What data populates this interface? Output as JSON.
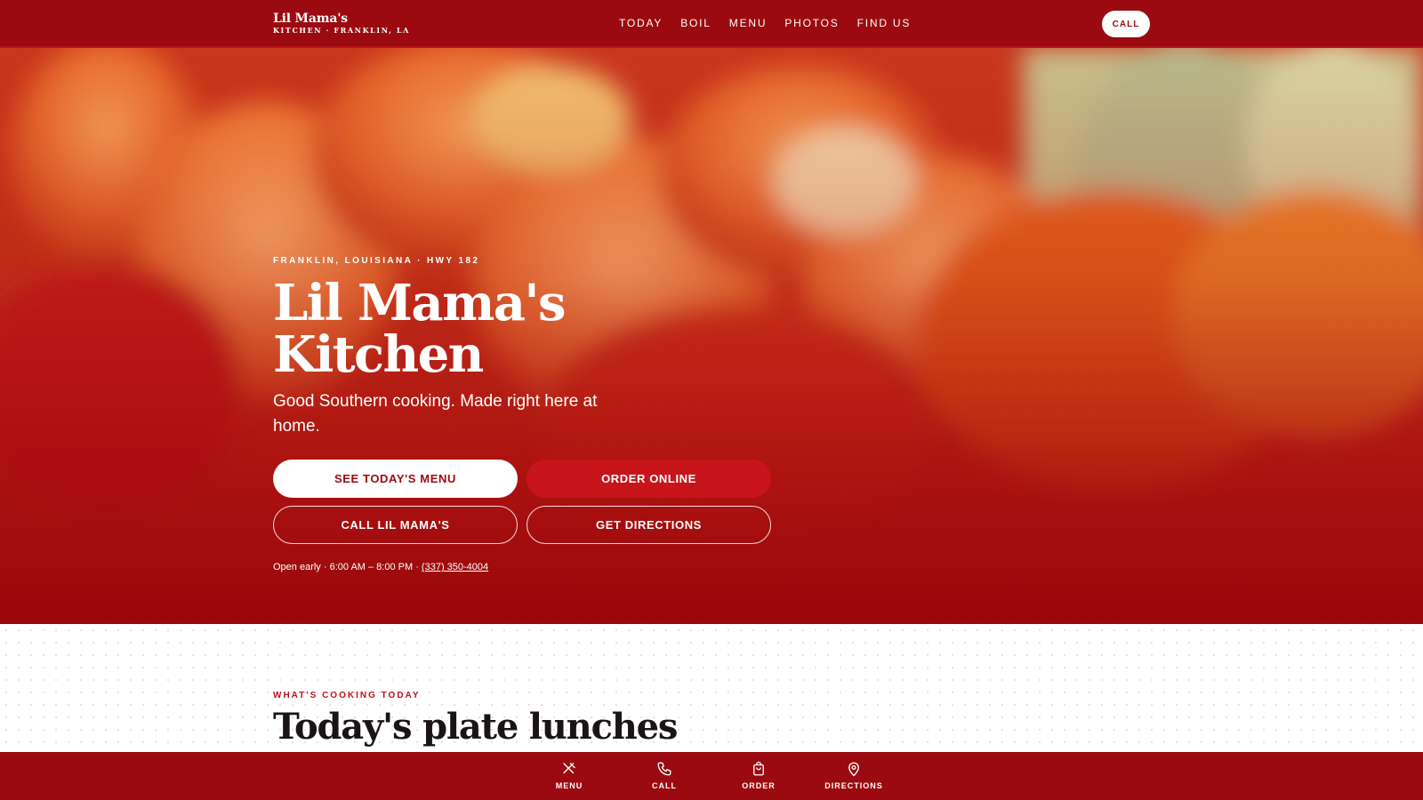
{
  "header": {
    "brand_name": "Lil Mama's",
    "brand_sub": "KITCHEN · FRANKLIN, LA",
    "nav": [
      "TODAY",
      "BOIL",
      "MENU",
      "PHOTOS",
      "FIND US"
    ],
    "call_label": "CALL"
  },
  "hero": {
    "eyebrow": "FRANKLIN, LOUISIANA · HWY 182",
    "title": "Lil Mama's Kitchen",
    "tagline": "Good Southern cooking. Made right here at home.",
    "buttons": {
      "menu": "SEE TODAY'S MENU",
      "order": "ORDER ONLINE",
      "call": "CALL LIL MAMA'S",
      "directions": "GET DIRECTIONS"
    },
    "hours_text": "Open early · 6:00 AM – 8:00 PM · ",
    "phone": "(337) 350-4004"
  },
  "section": {
    "eyebrow": "WHAT'S COOKING TODAY",
    "title": "Today's plate lunches"
  },
  "bottom_nav": {
    "menu": "MENU",
    "call": "CALL",
    "order": "ORDER",
    "directions": "DIRECTIONS"
  },
  "colors": {
    "brand_red": "#9b0a10",
    "button_red": "#c8141b",
    "white": "#ffffff"
  }
}
